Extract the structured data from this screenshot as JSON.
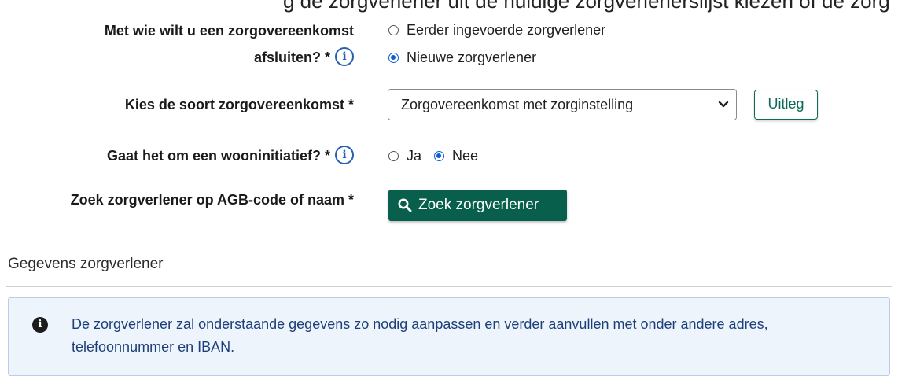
{
  "top_partial_text": "g  de zorgverlener uit de huidige  zorgverlenerslijst  kiezen of de zorg",
  "fields": {
    "zorgovereenkomst_partner": {
      "label_line1": "Met wie wilt u een zorgovereenkomst",
      "label_line2": "afsluiten? *",
      "options": [
        "Eerder ingevoerde zorgverlener",
        "Nieuwe zorgverlener"
      ],
      "selected": "Nieuwe zorgverlener"
    },
    "soort_zorgovereenkomst": {
      "label": "Kies de soort zorgovereenkomst *",
      "value": "Zorgovereenkomst met zorginstelling",
      "help_button": "Uitleg"
    },
    "wooninitiatief": {
      "label": "Gaat het om een wooninitiatief? *",
      "options": [
        "Ja",
        "Nee"
      ],
      "selected": "Nee"
    },
    "zoek_zorgverlener": {
      "label": "Zoek zorgverlener op AGB-code of naam *",
      "button": "Zoek zorgverlener"
    }
  },
  "section": {
    "title": "Gegevens zorgverlener",
    "alert_text": "De zorgverlener zal onderstaande gegevens zo nodig aanpassen en verder aanvullen met onder andere adres, telefoonnummer en IBAN."
  },
  "icons": {
    "info": "info-circle-icon",
    "search": "search-icon",
    "chevron": "chevron-down-icon",
    "alert": "info-filled-icon"
  },
  "colors": {
    "primary": "#075f4c",
    "radio_checked": "#0b5cd6",
    "info_icon": "#2a5db0",
    "alert_bg": "#eef4fb",
    "alert_text": "#1c3f7a"
  }
}
